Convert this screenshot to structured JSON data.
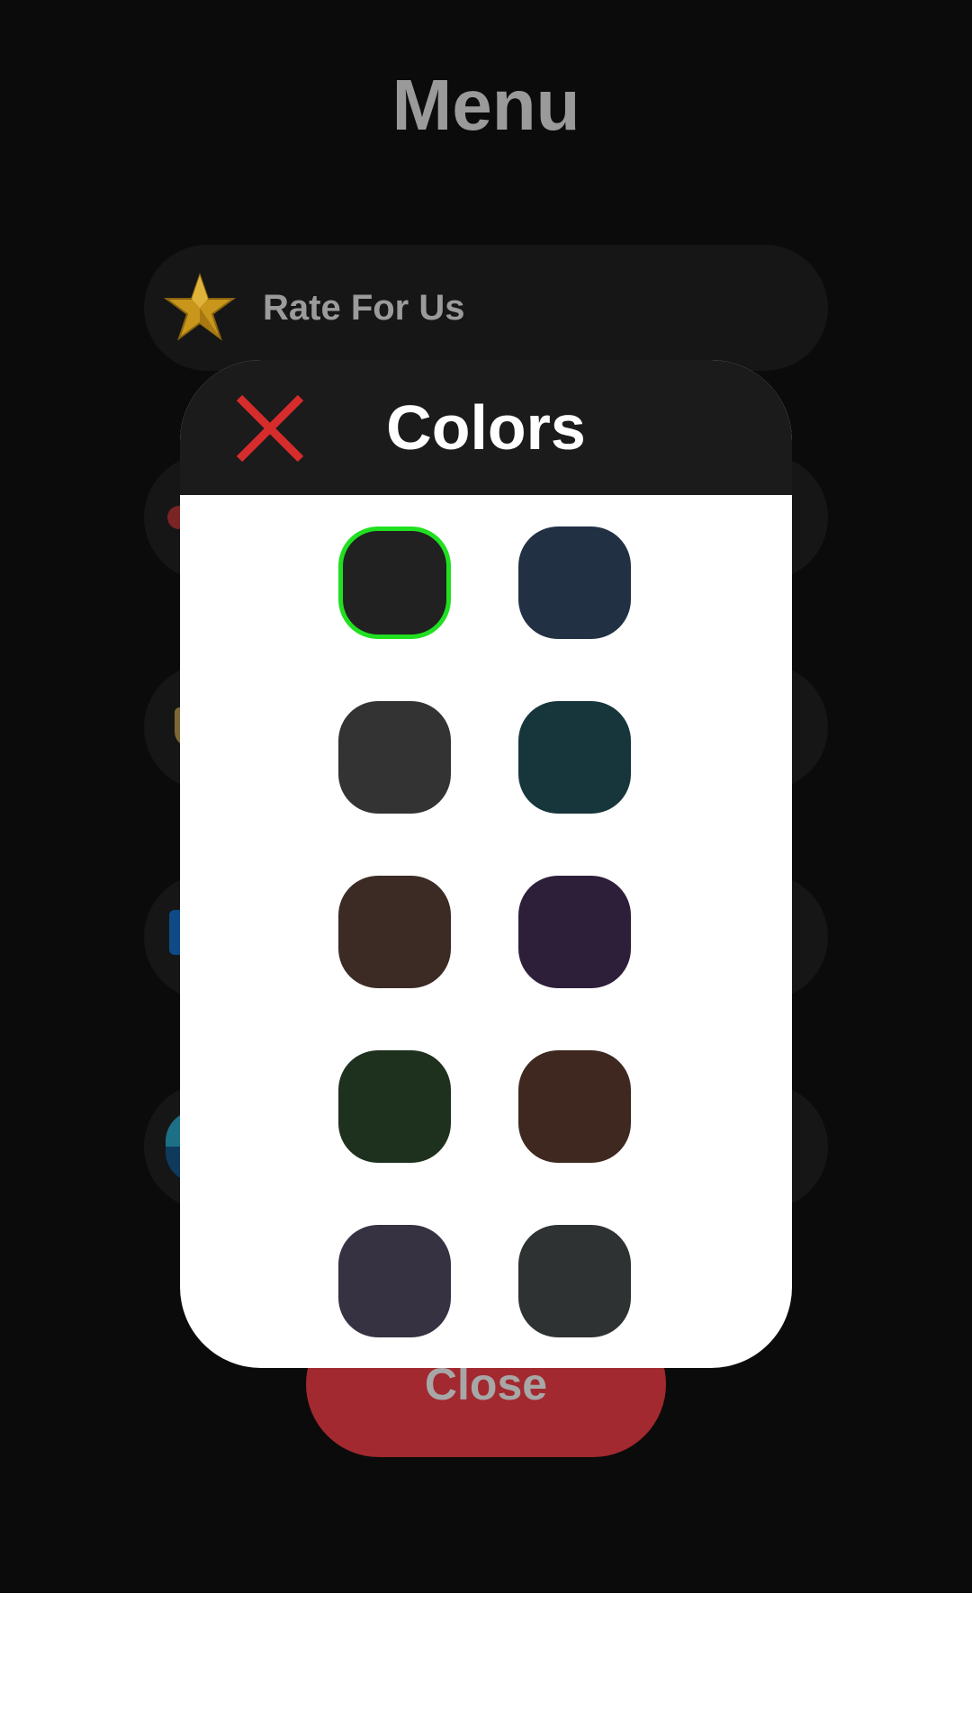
{
  "menu": {
    "title": "Menu",
    "items": [
      {
        "label": "Rate For Us",
        "icon": "star-icon"
      }
    ],
    "partial_items": [
      {
        "icon": "red-dot-icon"
      },
      {
        "icon": "shield-icon"
      },
      {
        "icon": "blue-app-icon"
      },
      {
        "icon": "globe-icon"
      }
    ],
    "close_label": "Close"
  },
  "dialog": {
    "title": "Colors",
    "close_icon": "close-icon",
    "selected_index": 0,
    "colors": [
      "#212121",
      "#223044",
      "#333333",
      "#17363b",
      "#3b2b24",
      "#2d1e3a",
      "#1e311e",
      "#3e2820",
      "#363242",
      "#2e3232"
    ]
  },
  "colors": {
    "background": "#0b0b0b",
    "menu_item_bg": "#161616",
    "close_button": "#a2292f",
    "dialog_header": "#1b1b1b",
    "close_icon": "#d72c2c",
    "selected_border": "#21e021"
  }
}
